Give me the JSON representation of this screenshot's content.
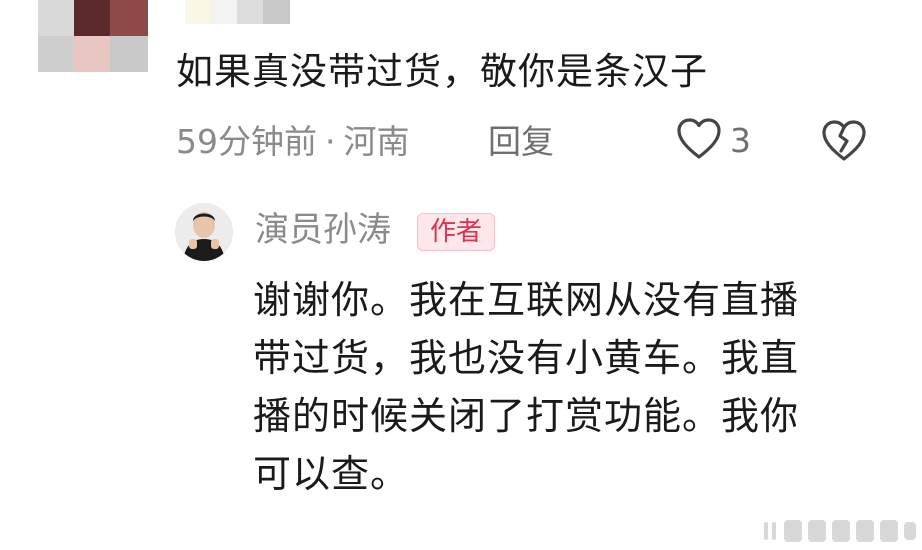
{
  "comment": {
    "text": "如果真没带过货，敬你是条汉子",
    "time": "59分钟前",
    "separator": "·",
    "location": "河南",
    "reply_label": "回复",
    "like_count": "3",
    "icons": {
      "like": "heart-outline-icon",
      "dislike": "broken-heart-icon"
    }
  },
  "reply": {
    "author_name": "演员孙涛",
    "author_badge": "作者",
    "lines": [
      "谢谢你。我在互联网从没有直播",
      "带过货，我也没有小黄车。我直",
      "播的时候关闭了打赏功能。我你",
      "可以查。"
    ]
  },
  "colors": {
    "badge_bg": "#fde7ea",
    "badge_text": "#e0324e",
    "meta_text": "#8a8a8a",
    "body_text": "#1a1a1a"
  }
}
